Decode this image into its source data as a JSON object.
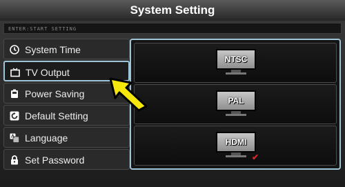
{
  "title": "System Setting",
  "hint": "ENTER:START SETTING",
  "menu": {
    "items": [
      {
        "label": "System Time",
        "icon": "clock-icon"
      },
      {
        "label": "TV Output",
        "icon": "tv-icon"
      },
      {
        "label": "Power Saving",
        "icon": "battery-icon"
      },
      {
        "label": "Default Setting",
        "icon": "reset-icon"
      },
      {
        "label": "Language",
        "icon": "language-icon"
      },
      {
        "label": "Set Password",
        "icon": "lock-icon"
      }
    ],
    "selected": "TV Output"
  },
  "options": [
    {
      "label": "NTSC",
      "selected": false
    },
    {
      "label": "PAL",
      "selected": false
    },
    {
      "label": "HDMI",
      "selected": true
    }
  ],
  "check_mark": "✔",
  "colors": {
    "highlight": "#9fc5d8",
    "check": "#d8262b",
    "cursor": "#f5e60c"
  }
}
